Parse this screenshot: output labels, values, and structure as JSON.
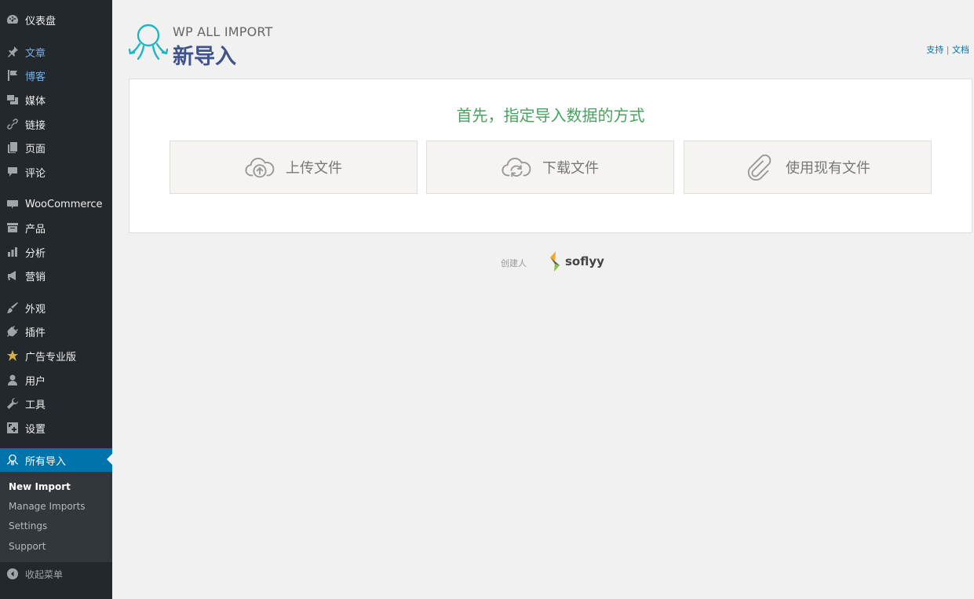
{
  "sidebar": {
    "items": [
      {
        "label": "仪表盘",
        "icon": "dashboard-icon"
      },
      {
        "label": "文章",
        "icon": "pin-icon"
      },
      {
        "label": "博客",
        "icon": "flag-icon"
      },
      {
        "label": "媒体",
        "icon": "media-icon"
      },
      {
        "label": "链接",
        "icon": "link-icon"
      },
      {
        "label": "页面",
        "icon": "page-icon"
      },
      {
        "label": "评论",
        "icon": "comment-icon"
      },
      {
        "label": "WooCommerce",
        "icon": "woo-icon"
      },
      {
        "label": "产品",
        "icon": "archive-icon"
      },
      {
        "label": "分析",
        "icon": "chart-icon"
      },
      {
        "label": "营销",
        "icon": "megaphone-icon"
      },
      {
        "label": "外观",
        "icon": "brush-icon"
      },
      {
        "label": "插件",
        "icon": "plugin-icon"
      },
      {
        "label": "广告专业版",
        "icon": "star-icon"
      },
      {
        "label": "用户",
        "icon": "user-icon"
      },
      {
        "label": "工具",
        "icon": "wrench-icon"
      },
      {
        "label": "设置",
        "icon": "settings-icon"
      },
      {
        "label": "所有导入",
        "icon": "octopus-icon"
      }
    ],
    "submenu": [
      "New Import",
      "Manage Imports",
      "Settings",
      "Support"
    ],
    "collapse_label": "收起菜单"
  },
  "header": {
    "logo_brand": "WP ALL IMPORT",
    "page_title": "新导入",
    "support_link": "支持",
    "separator": "|",
    "docs_link": "文档"
  },
  "main": {
    "prompt": "首先，指定导入数据的方式",
    "options": [
      {
        "label": "上传文件",
        "icon": "cloud-upload-icon"
      },
      {
        "label": "下载文件",
        "icon": "cloud-sync-icon"
      },
      {
        "label": "使用现有文件",
        "icon": "paperclip-icon"
      }
    ]
  },
  "footer": {
    "credit_label": "创建人",
    "brand": "soflyy"
  },
  "colors": {
    "sidebar_bg": "#23282d",
    "active_bg": "#0073aa",
    "accent_green": "#46a35e",
    "logo_teal": "#1fb5c4",
    "logo_navy": "#40538a"
  }
}
